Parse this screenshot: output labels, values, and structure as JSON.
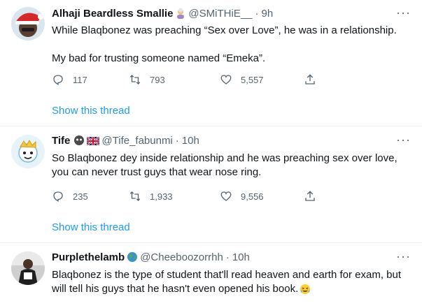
{
  "tweets": [
    {
      "name": "Alhaji Beardless Smallie",
      "handle": "@SMiTHiE__",
      "time": "9h",
      "text_lines": [
        "While Blaqbonez was preaching “Sex over Love”, he was in a relationship.",
        "My bad for trusting someone named “Emeka”."
      ],
      "replies": "117",
      "retweets": "793",
      "likes": "5,557",
      "show_thread": "Show this thread"
    },
    {
      "name": "Tife",
      "handle": "@Tife_fabunmi",
      "time": "10h",
      "text_lines": [
        "So Blaqbonez dey inside relationship and he was preaching sex over love,",
        "you can never trust guys that wear nose ring."
      ],
      "replies": "235",
      "retweets": "1,933",
      "likes": "9,556",
      "show_thread": "Show this thread"
    },
    {
      "name": "Purplethelamb",
      "handle": "@Cheeboozorrhh",
      "time": "10h",
      "text_lines": [
        "Blaqbonez is the type of student that'll read heaven and earth for exam, but",
        "will tell his guys that he hasn't even opened his book."
      ]
    }
  ],
  "colors": {
    "link": "#1d9bf0",
    "muted": "#536471",
    "text": "#0f1419",
    "divider": "#eff3f4"
  },
  "icons": [
    "reply-icon",
    "retweet-icon",
    "like-icon",
    "share-icon",
    "more-icon",
    "globe-icon",
    "laughing-emoji-icon",
    "uk-flag-icon"
  ]
}
